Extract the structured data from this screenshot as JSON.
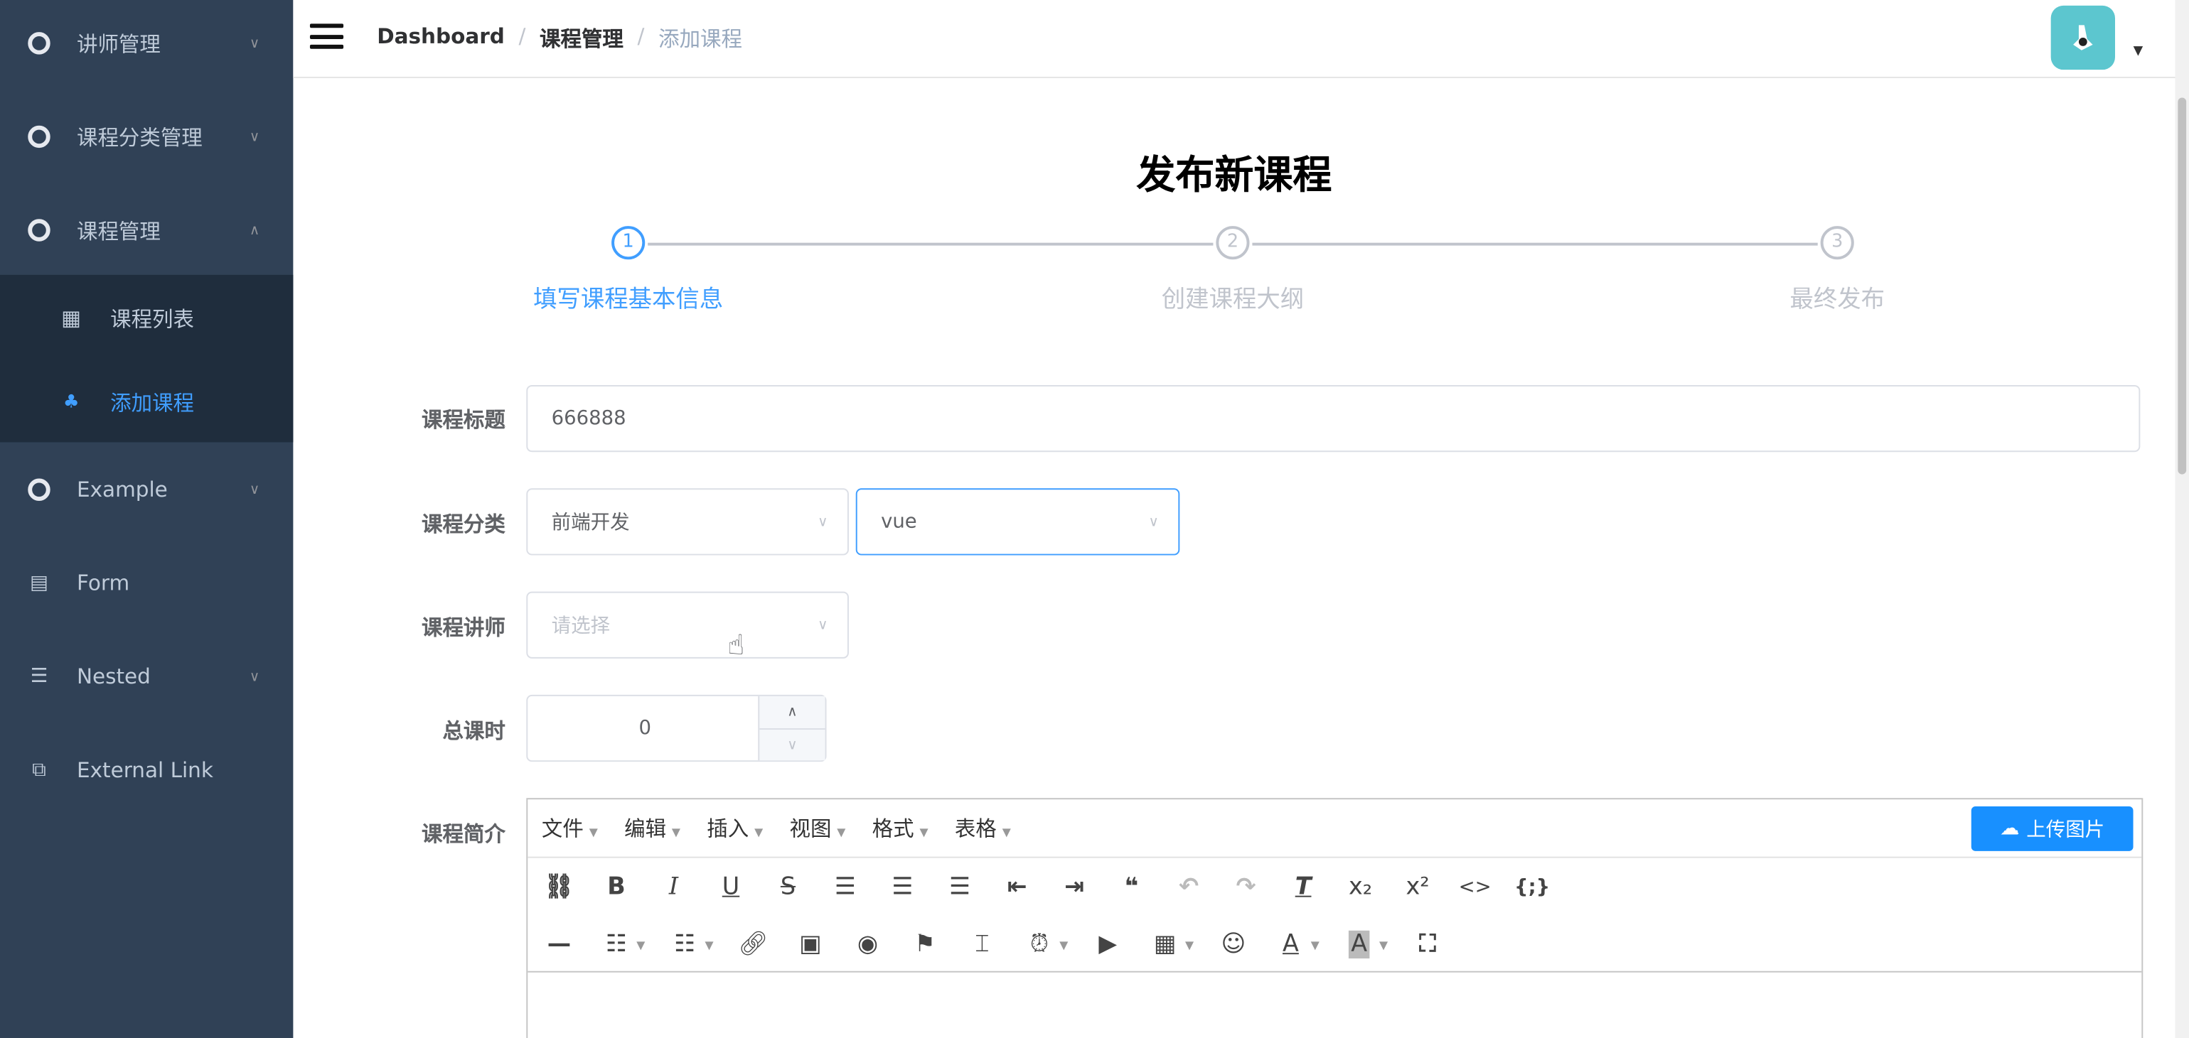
{
  "sidebar": {
    "items": [
      {
        "label": "讲师管理",
        "icon": "lifebuoy-icon",
        "expanded": false
      },
      {
        "label": "课程分类管理",
        "icon": "lifebuoy-icon",
        "expanded": false
      },
      {
        "label": "课程管理",
        "icon": "lifebuoy-icon",
        "expanded": true
      },
      {
        "label": "课程列表",
        "icon": "table-icon"
      },
      {
        "label": "添加课程",
        "icon": "tree-icon",
        "active": true
      },
      {
        "label": "Example",
        "icon": "lifebuoy-icon",
        "expanded": false
      },
      {
        "label": "Form",
        "icon": "form-icon"
      },
      {
        "label": "Nested",
        "icon": "list-icon",
        "expanded": false
      },
      {
        "label": "External Link",
        "icon": "external-link-icon"
      }
    ]
  },
  "header": {
    "breadcrumb": [
      "Dashboard",
      "课程管理",
      "添加课程"
    ],
    "separator": "/"
  },
  "page": {
    "title": "发布新课程"
  },
  "steps": [
    {
      "num": "1",
      "label": "填写课程基本信息",
      "active": true
    },
    {
      "num": "2",
      "label": "创建课程大纲"
    },
    {
      "num": "3",
      "label": "最终发布"
    }
  ],
  "form": {
    "title_label": "课程标题",
    "title_value": "666888",
    "category_label": "课程分类",
    "category_primary": "前端开发",
    "category_secondary": "vue",
    "teacher_label": "课程讲师",
    "teacher_placeholder": "请选择",
    "hours_label": "总课时",
    "hours_value": "0",
    "intro_label": "课程简介"
  },
  "editor": {
    "menus": [
      "文件",
      "编辑",
      "插入",
      "视图",
      "格式",
      "表格"
    ],
    "upload_label": "上传图片"
  },
  "colors": {
    "sidebar_bg": "#304156",
    "accent": "#409eff",
    "upload_btn": "#1890ff"
  }
}
